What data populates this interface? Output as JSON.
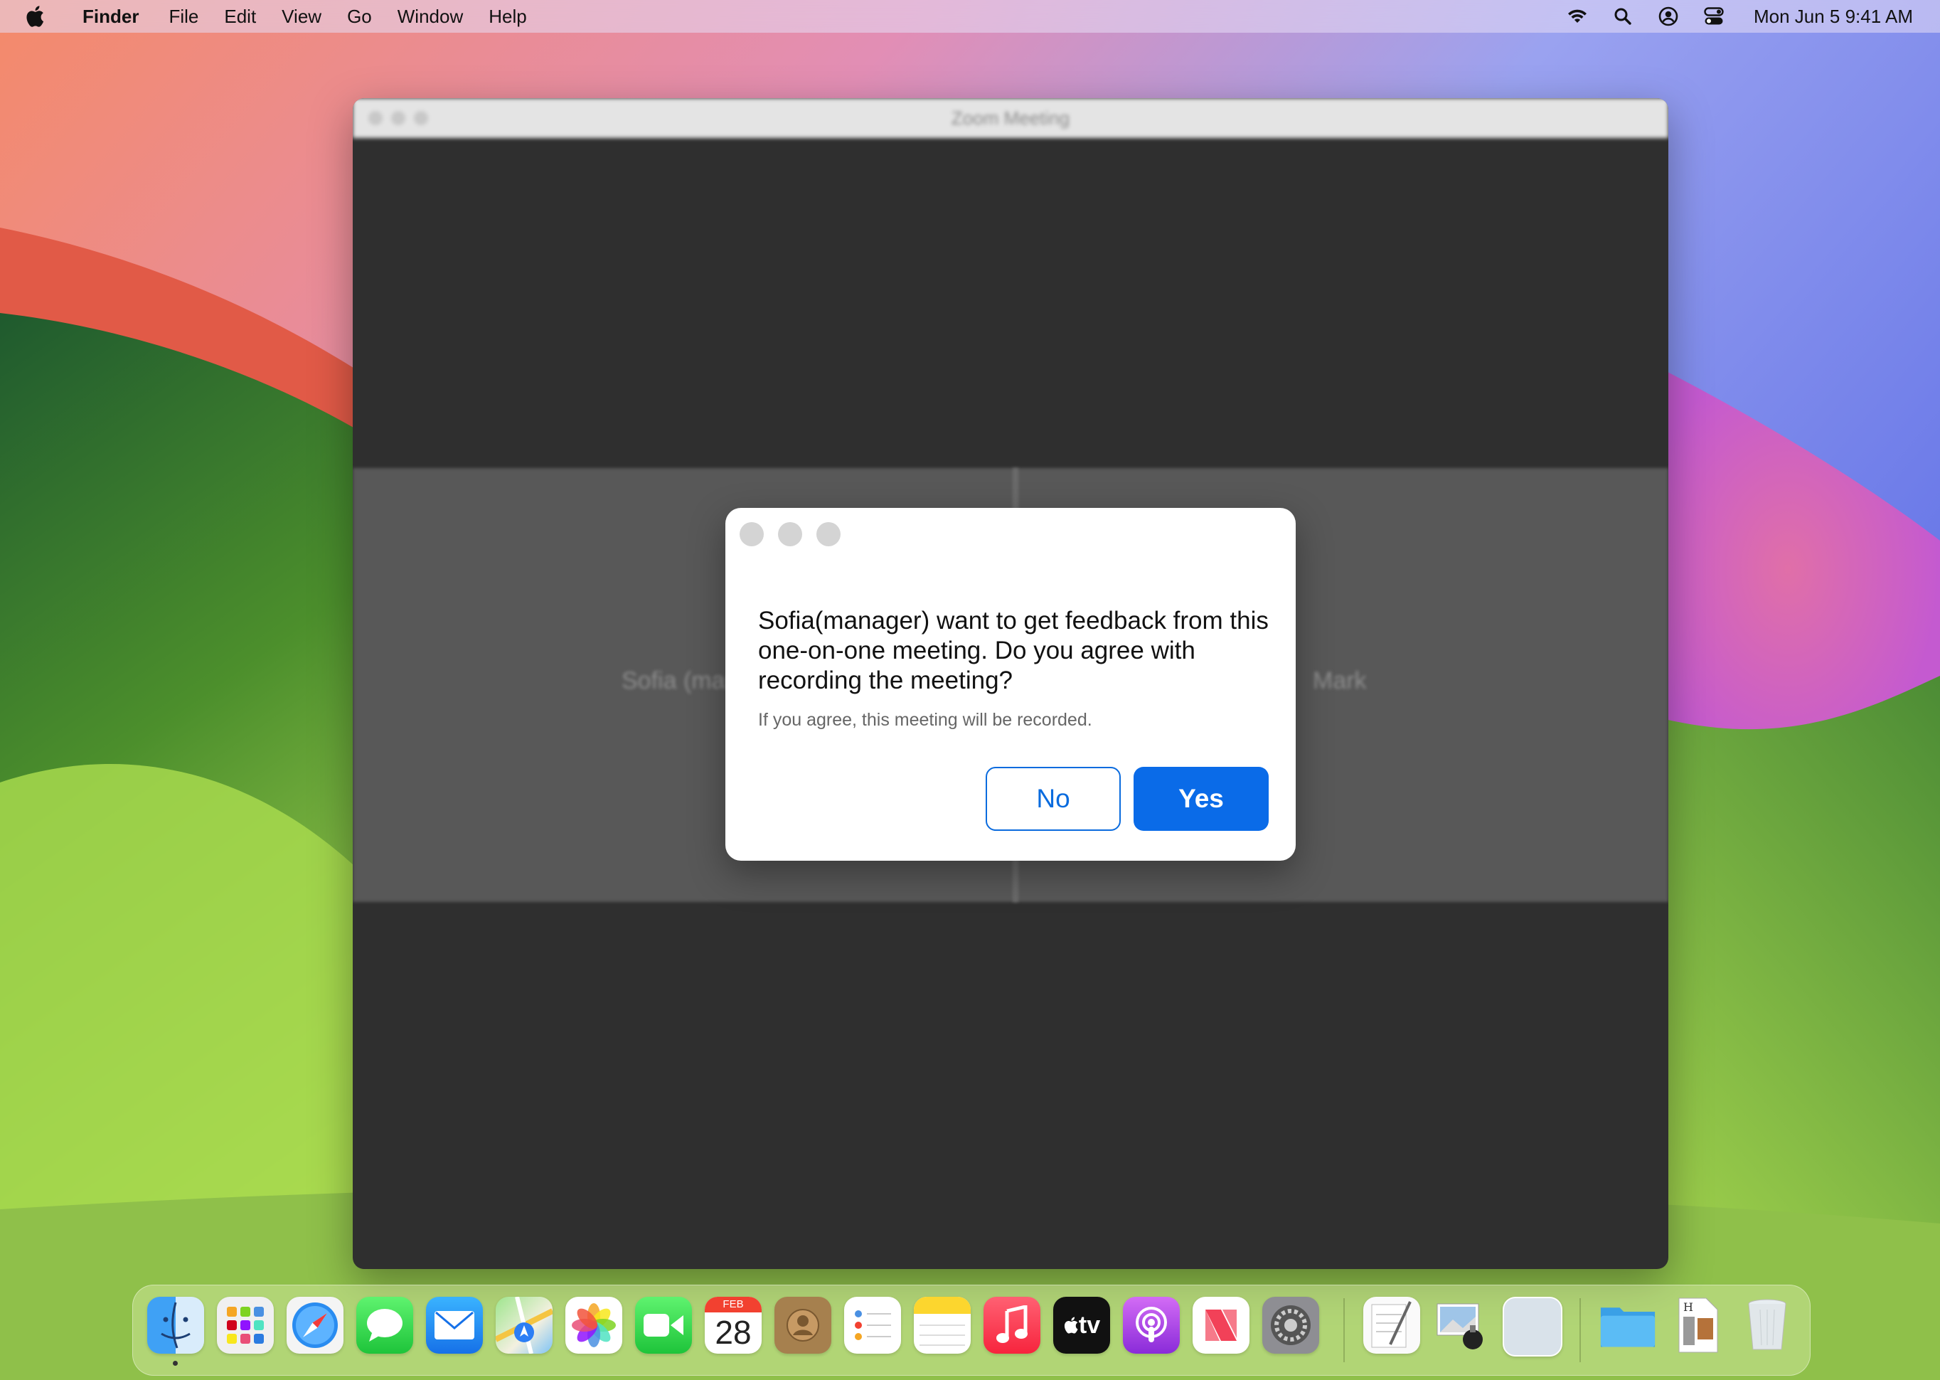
{
  "menubar": {
    "app_name": "Finder",
    "menus": [
      "File",
      "Edit",
      "View",
      "Go",
      "Window",
      "Help"
    ],
    "clock": "Mon Jun 5  9:41 AM",
    "status_icons": [
      "wifi-icon",
      "search-icon",
      "user-icon",
      "control-center-icon"
    ]
  },
  "zoom_window": {
    "title": "Zoom Meeting",
    "participants": [
      "Sofia (manager)",
      "Mark"
    ]
  },
  "dialog": {
    "title": "Sofia(manager) want to get feedback from this one-on-one meeting. Do you agree with recording the meeting?",
    "subtitle": "If you agree, this meeting will be recorded.",
    "no_label": "No",
    "yes_label": "Yes"
  },
  "dock": {
    "apps": [
      "Finder",
      "Launchpad",
      "Safari",
      "Messages",
      "Mail",
      "Maps",
      "Photos",
      "FaceTime",
      "Calendar",
      "Contacts",
      "Reminders",
      "Notes",
      "Music",
      "TV",
      "Podcasts",
      "News",
      "System Settings",
      "TextEdit",
      "Preview",
      "Blank",
      "Folder",
      "Document",
      "Trash"
    ],
    "calendar_month": "FEB",
    "calendar_day": "28",
    "tv_label": "tv"
  },
  "colors": {
    "accent": "#0a6be8",
    "dialog_bg": "#ffffff",
    "zoom_bg": "#2f2f2f"
  }
}
